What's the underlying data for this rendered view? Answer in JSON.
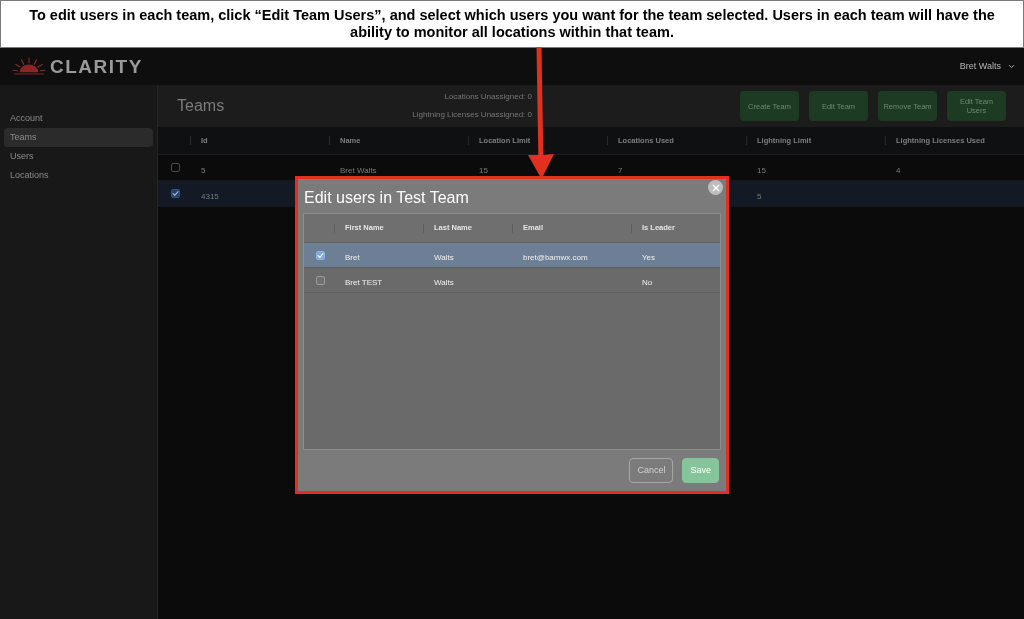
{
  "annotation": {
    "text": "To edit users in each team, click “Edit Team Users”, and select which users you want for the team selected. Users in each team will have the ability to monitor all locations within that team."
  },
  "header": {
    "logo": "CLARITY",
    "user_menu": "Bret Walts"
  },
  "sidebar": {
    "items": [
      {
        "label": "Account",
        "selected": false
      },
      {
        "label": "Teams",
        "selected": true
      },
      {
        "label": "Users",
        "selected": false
      },
      {
        "label": "Locations",
        "selected": false
      }
    ]
  },
  "page": {
    "title": "Teams",
    "summary": [
      "Locations Unassigned: 0",
      "Lightning Licenses Unassigned: 0"
    ],
    "buttons": [
      "Create Team",
      "Edit Team",
      "Remove Team",
      "Edit Team Users"
    ]
  },
  "table": {
    "columns": [
      "Id",
      "Name",
      "Location Limit",
      "Locations Used",
      "Lightning Limit",
      "Lightning Licenses Used"
    ],
    "rows": [
      {
        "checked": false,
        "selected": false,
        "id": "5",
        "name": "Bret Walts",
        "location_limit": "15",
        "locations_used": "7",
        "lightning_limit": "15",
        "lightning_licenses_used": "4"
      },
      {
        "checked": true,
        "selected": true,
        "id": "4315",
        "lightning_limit": "5"
      }
    ]
  },
  "dialog": {
    "title": "Edit users in Test Team",
    "columns": [
      "First Name",
      "Last Name",
      "Email",
      "Is Leader"
    ],
    "rows": [
      {
        "checked": true,
        "selected": true,
        "first_name": "Bret",
        "last_name": "Walts",
        "email": "bret@bamwx.com",
        "is_leader": "Yes"
      },
      {
        "checked": false,
        "selected": false,
        "first_name": "Bret TEST",
        "last_name": "Walts",
        "is_leader": "No"
      }
    ],
    "buttons": [
      {
        "label": "Cancel",
        "kind": "secondary"
      },
      {
        "label": "Save",
        "kind": "primary"
      }
    ]
  }
}
